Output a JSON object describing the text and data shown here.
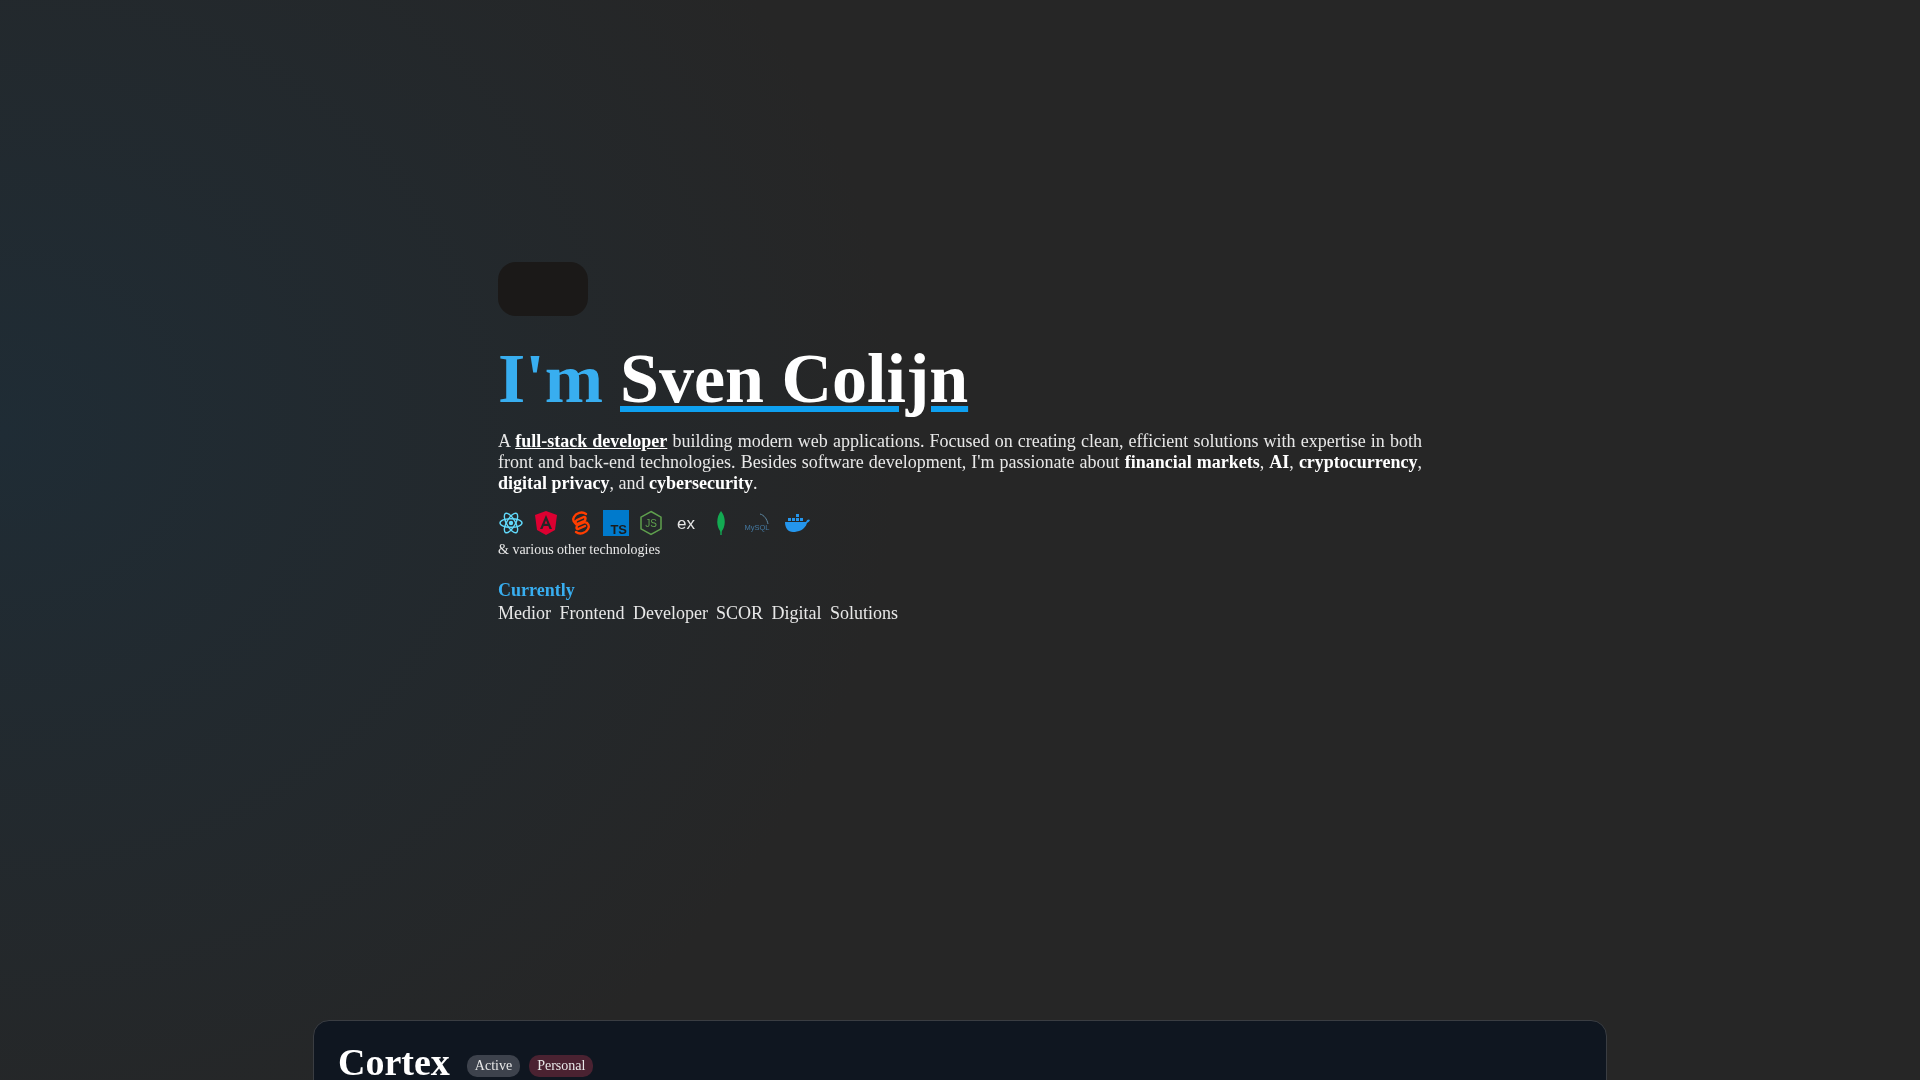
{
  "hero": {
    "greeting": "I'm",
    "name": "Sven Colijn"
  },
  "intro": {
    "before": "A",
    "link": "full-stack developer",
    "after": "building modern web applications. Focused on creating clean, efficient solutions with expertise in both front and back-end technologies. Besides software development, I'm passionate about **financial markets**, **AI**, **cryptocurrency**, **digital privacy**, and **cybersecurity**."
  },
  "tech": [
    {
      "kind": "react"
    },
    {
      "kind": "angular"
    },
    {
      "kind": "svelte"
    },
    {
      "kind": "typescript",
      "label": "TS"
    },
    {
      "kind": "nodejs",
      "label": "JS"
    },
    {
      "kind": "express",
      "label": "ex"
    },
    {
      "kind": "mongodb"
    },
    {
      "kind": "mysql",
      "label": "MySQL"
    },
    {
      "kind": "docker"
    }
  ],
  "tech_note": "& various other technologies",
  "current": {
    "heading": "Currently",
    "role": "Medior Frontend Developer",
    "company": "SCOR Digital Solutions"
  },
  "project": {
    "title": "Cortex",
    "tags": [
      {
        "label": "Active",
        "color": "#3d424c"
      },
      {
        "label": "Personal",
        "color": "#4a2231"
      }
    ]
  }
}
